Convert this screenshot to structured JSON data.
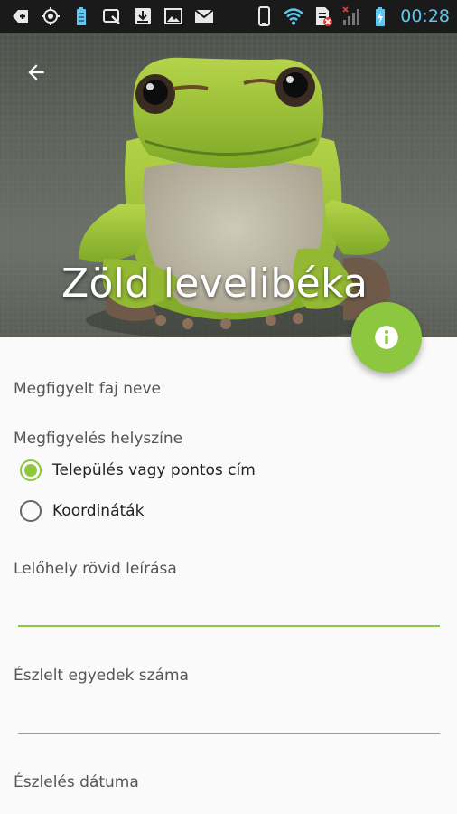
{
  "status_bar": {
    "time": "00:28",
    "left_icons": [
      "usb-debug-icon",
      "gps-icon",
      "battery-saver-icon",
      "screen-icon",
      "download-icon",
      "image-icon",
      "email-icon"
    ],
    "right_icons": [
      "rotation-icon",
      "wifi-icon",
      "sim-error-icon",
      "signal-icon",
      "battery-charging-icon"
    ]
  },
  "header": {
    "title": "Zöld levelibéka",
    "back_icon": "arrow-back-icon",
    "info_icon": "info-icon"
  },
  "form": {
    "species_label": "Megfigyelt faj neve",
    "location_label": "Megfigyelés helyszíne",
    "location_options": [
      {
        "label": "Település vagy pontos cím",
        "selected": true
      },
      {
        "label": "Koordináták",
        "selected": false
      }
    ],
    "site_description_label": "Lelőhely rövid leírása",
    "site_description_value": "",
    "count_label": "Észlelt egyedek száma",
    "count_value": "",
    "date_label": "Észlelés dátuma"
  },
  "colors": {
    "accent": "#8dc63f",
    "status_time": "#5ec9f0",
    "background": "#fafafa"
  }
}
